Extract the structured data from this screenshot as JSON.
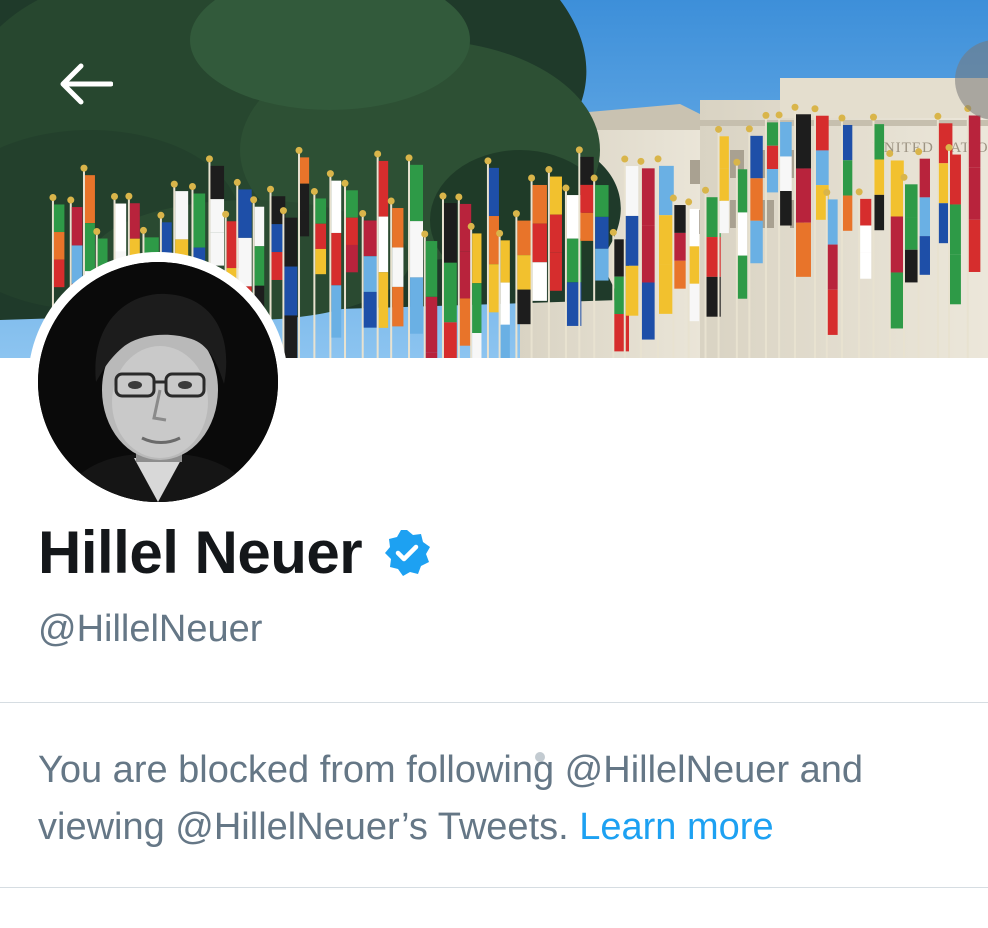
{
  "profile": {
    "name": "Hillel Neuer",
    "handle": "@HillelNeuer",
    "verified": true
  },
  "banner": {
    "sign_text": "UNITED NATIO"
  },
  "blocked_notice": {
    "text": "You are blocked from following @HillelNeuer and viewing @HillelNeuer’s Tweets. ",
    "link_label": "Learn more"
  },
  "icons": {
    "back": "back-arrow-icon",
    "verified": "verified-badge-icon"
  },
  "colors": {
    "link": "#1da1f2",
    "secondary_text": "#657786",
    "primary_text": "#14171a",
    "verified": "#1da1f2"
  }
}
